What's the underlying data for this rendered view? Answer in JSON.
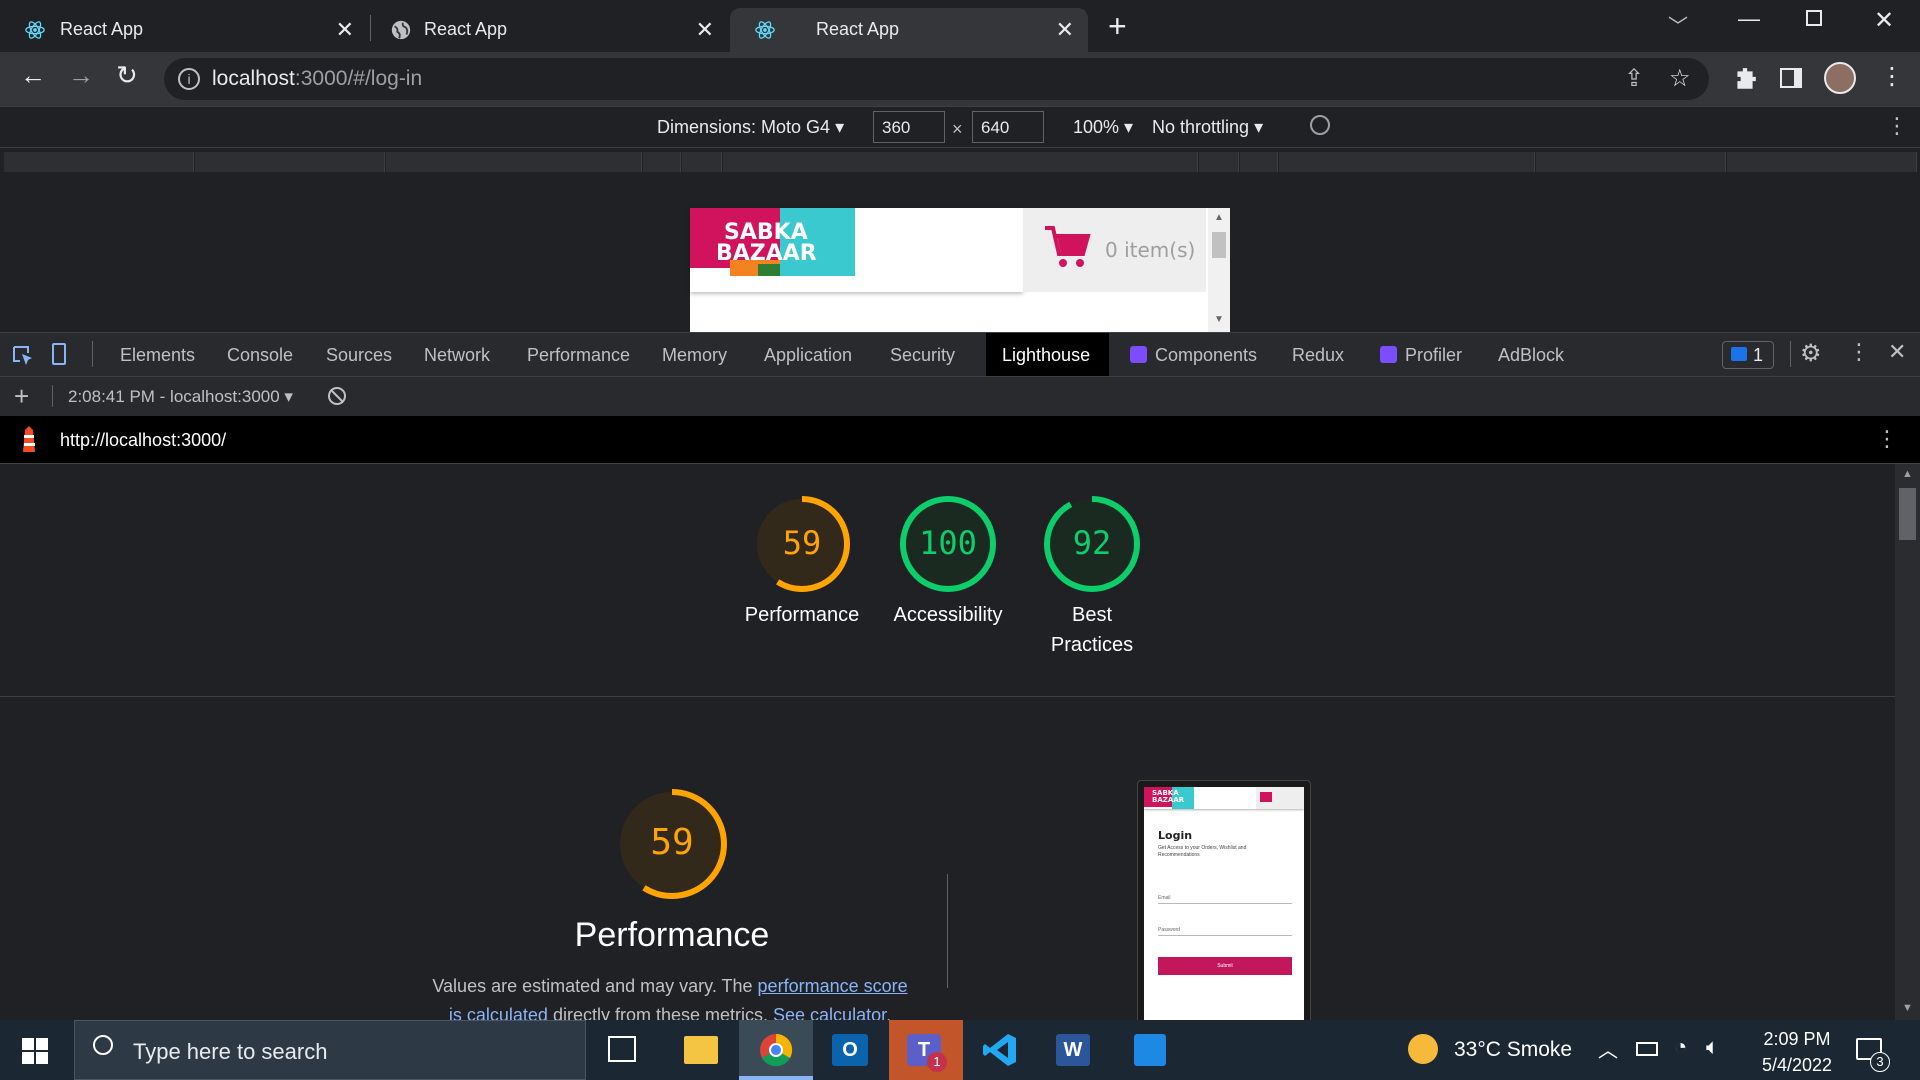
{
  "browser": {
    "tabs": [
      {
        "label": "React App",
        "icon": "react-icon",
        "active": false
      },
      {
        "label": "React App",
        "icon": "globe-icon",
        "active": false
      },
      {
        "label": "React App",
        "icon": "react-icon",
        "active": true
      }
    ],
    "new_tab": "+",
    "url_host": "localhost",
    "url_rest": ":3000/#/log-in"
  },
  "device_toolbar": {
    "dimensions_label": "Dimensions: Moto G4",
    "width": "360",
    "height": "640",
    "times": "×",
    "zoom": "100%",
    "throttling": "No throttling"
  },
  "site": {
    "logo_line1": "SABKA",
    "logo_line2": "BAZAAR",
    "cart_text": "0 item(s)"
  },
  "devtools": {
    "tabs": [
      "Elements",
      "Console",
      "Sources",
      "Network",
      "Performance",
      "Memory",
      "Application",
      "Security",
      "Lighthouse",
      "Components",
      "Redux",
      "Profiler",
      "AdBlock"
    ],
    "active_tab": "Lighthouse",
    "issues_count": "1",
    "report_selector": "2:08:41 PM - localhost:3000",
    "report_url": "http://localhost:3000/"
  },
  "lighthouse": {
    "scores": [
      {
        "value": "59",
        "label": "Performance",
        "color": "#ffa400"
      },
      {
        "value": "100",
        "label": "Accessibility",
        "color": "#0cce6b"
      },
      {
        "value": "92",
        "label": "Best Practices",
        "color": "#0cce6b"
      }
    ],
    "big_score": "59",
    "big_title": "Performance",
    "desc_1": "Values are estimated and may vary. The ",
    "desc_link1": "performance score",
    "desc_link2": "is calculated",
    "desc_2": " directly from these metrics. ",
    "desc_link3": "See calculator.",
    "thumb": {
      "logo_line1": "SABKA",
      "logo_line2": "BAZAAR",
      "login_title": "Login",
      "login_sub": "Get Access to your Orders, Wishlist and Recommendations",
      "email_label": "Email",
      "password_label": "Password",
      "submit": "Submit"
    }
  },
  "taskbar": {
    "search_placeholder": "Type here to search",
    "weather": "33°C  Smoke",
    "time": "2:09 PM",
    "date": "5/4/2022",
    "notif_count": "3",
    "teams_badge": "1"
  }
}
